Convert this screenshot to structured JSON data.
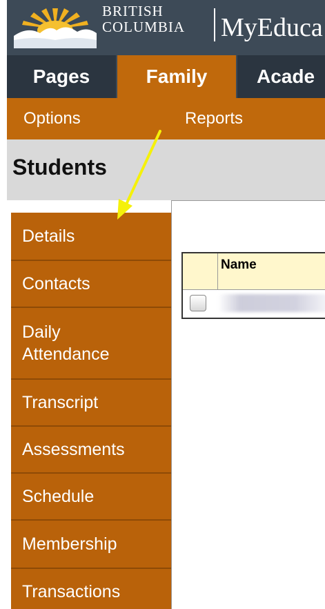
{
  "header": {
    "bc_line1": "BRITISH",
    "bc_line2": "COLUMBIA",
    "app_name": "MyEduca",
    "logo_icon": "bc-sun-mountain-logo"
  },
  "tabs": [
    {
      "label": "Pages"
    },
    {
      "label": "Family"
    },
    {
      "label": "Acade"
    }
  ],
  "subnav": {
    "options": "Options",
    "reports": "Reports"
  },
  "page_title": "Students",
  "side_menu": {
    "items": [
      {
        "label": "Details"
      },
      {
        "label": "Contacts"
      },
      {
        "label": "Daily Attendance"
      },
      {
        "label": "Transcript"
      },
      {
        "label": "Assessments"
      },
      {
        "label": "Schedule"
      },
      {
        "label": "Membership"
      },
      {
        "label": "Transactions"
      }
    ]
  },
  "table": {
    "name_header": "Name"
  },
  "colors": {
    "header_bg": "#3d4a57",
    "tab_dark": "#2b3540",
    "accent_orange": "#c0690c",
    "side_orange": "#b9620a",
    "annotation_arrow": "#f5f10a"
  }
}
